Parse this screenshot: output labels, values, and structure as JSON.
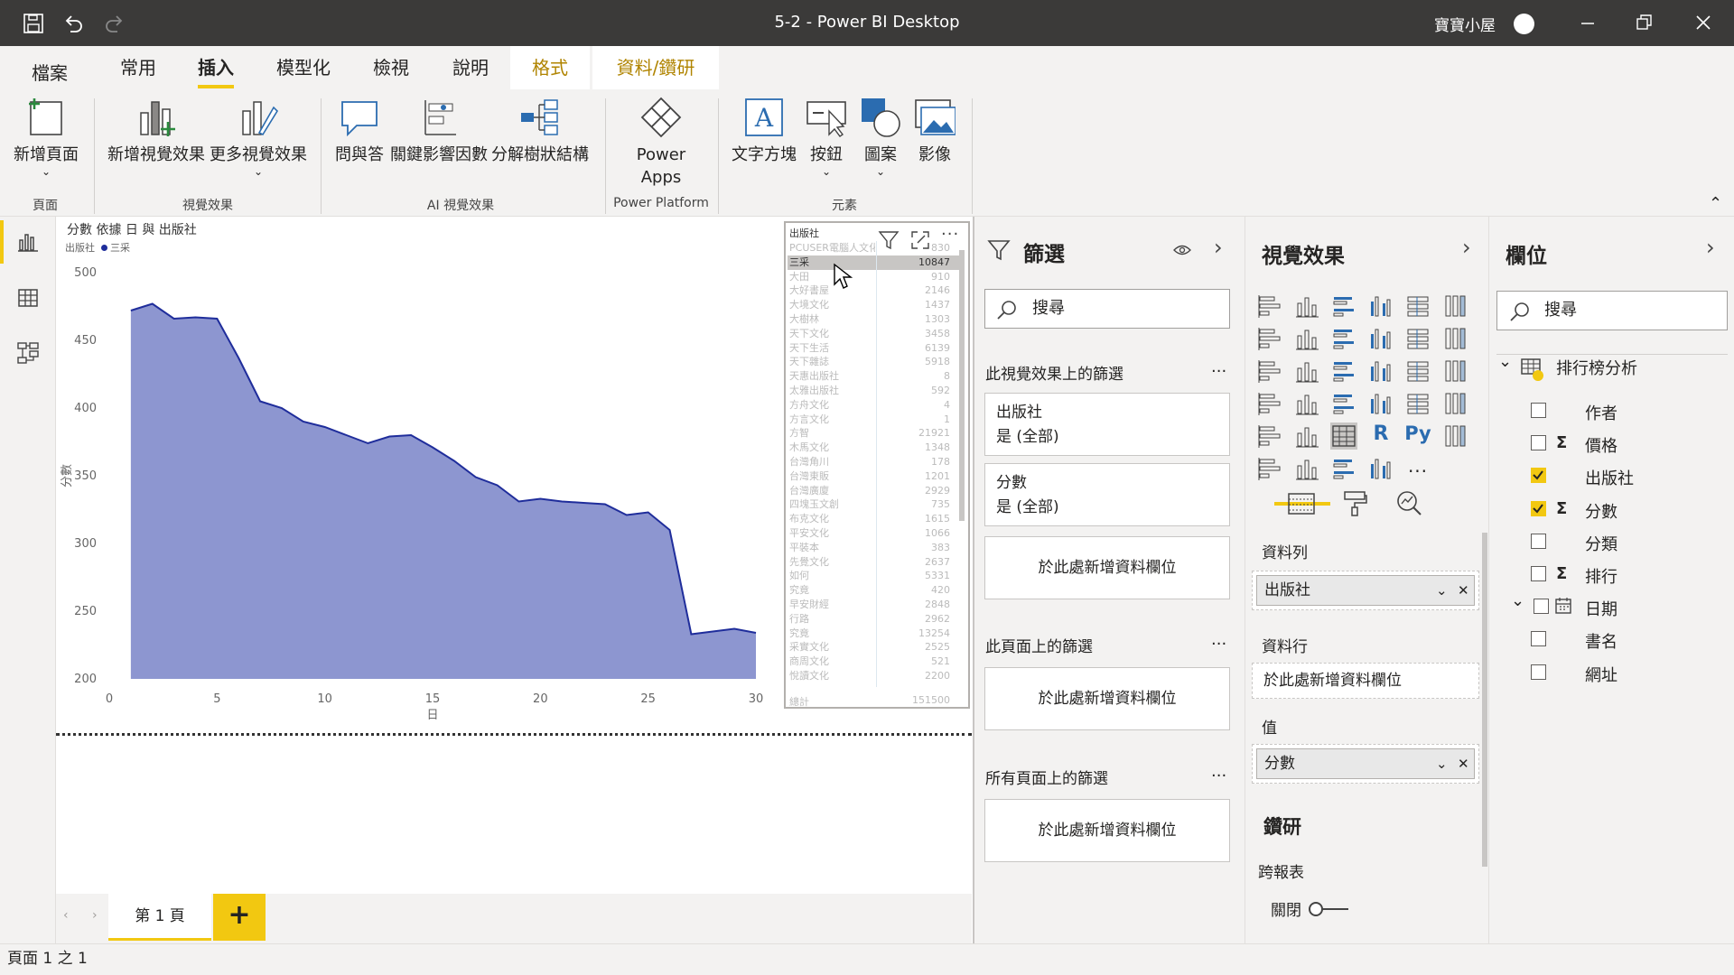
{
  "window": {
    "title": "5-2 - Power BI Desktop",
    "user": "寶寶小屋"
  },
  "tabs": [
    "檔案",
    "常用",
    "插入",
    "模型化",
    "檢視",
    "說明",
    "格式",
    "資料/鑽研"
  ],
  "ribbon": {
    "new_page": "新增頁面",
    "new_visual": "新增視覺效果",
    "more_visuals": "更多視覺效果",
    "qa": "問與答",
    "key_influencers": "關鍵影響因數",
    "decomp_tree": "分解樹狀結構",
    "power_apps_1": "Power",
    "power_apps_2": "Apps",
    "text_box": "文字方塊",
    "buttons": "按鈕",
    "shapes": "圖案",
    "image": "影像",
    "groups": {
      "page": "頁面",
      "visuals": "視覺效果",
      "ai": "AI 視覺效果",
      "platform": "Power Platform",
      "elements": "元素"
    }
  },
  "chart": {
    "title": "分數 依據 日 與 出版社",
    "legend_label": "出版社",
    "legend_item": "三采",
    "xlabel": "日",
    "ylabel": "分數"
  },
  "chart_data": {
    "type": "area",
    "title": "分數 依據 日 與 出版社",
    "xlabel": "日",
    "ylabel": "分數",
    "x": [
      1,
      2,
      3,
      4,
      5,
      6,
      7,
      8,
      9,
      10,
      11,
      12,
      13,
      14,
      15,
      16,
      17,
      18,
      19,
      20,
      21,
      22,
      23,
      24,
      25,
      26,
      27,
      28,
      29,
      30
    ],
    "series": [
      {
        "name": "三采",
        "values": [
          472,
          477,
          466,
          467,
          466,
          437,
          405,
          400,
          390,
          386,
          380,
          374,
          379,
          380,
          371,
          361,
          349,
          343,
          331,
          333,
          331,
          330,
          329,
          321,
          323,
          310,
          233,
          235,
          237,
          234
        ]
      }
    ],
    "xlim": [
      0,
      30
    ],
    "ylim": [
      200,
      500
    ],
    "xticks": [
      0,
      5,
      10,
      15,
      20,
      25,
      30
    ],
    "yticks": [
      200,
      250,
      300,
      350,
      400,
      450,
      500
    ],
    "grid": false,
    "legend": "top-left"
  },
  "table": {
    "header": "出版社",
    "rows": [
      {
        "name": "PCUSER電腦人文化",
        "value": "830"
      },
      {
        "name": "三采",
        "value": "10847"
      },
      {
        "name": "大田",
        "value": "910"
      },
      {
        "name": "大好書屋",
        "value": "2146"
      },
      {
        "name": "大境文化",
        "value": "1437"
      },
      {
        "name": "大樹林",
        "value": "1303"
      },
      {
        "name": "天下文化",
        "value": "3458"
      },
      {
        "name": "天下生活",
        "value": "6139"
      },
      {
        "name": "天下雜誌",
        "value": "5918"
      },
      {
        "name": "天惠出版社",
        "value": "8"
      },
      {
        "name": "太雅出版社",
        "value": "592"
      },
      {
        "name": "方舟文化",
        "value": "4"
      },
      {
        "name": "方言文化",
        "value": "1"
      },
      {
        "name": "方智",
        "value": "21921"
      },
      {
        "name": "木馬文化",
        "value": "1348"
      },
      {
        "name": "台灣角川",
        "value": "178"
      },
      {
        "name": "台灣東販",
        "value": "1201"
      },
      {
        "name": "台灣廣廈",
        "value": "2929"
      },
      {
        "name": "四塊玉文創",
        "value": "735"
      },
      {
        "name": "布克文化",
        "value": "1615"
      },
      {
        "name": "平安文化",
        "value": "1066"
      },
      {
        "name": "平裝本",
        "value": "383"
      },
      {
        "name": "先覺文化",
        "value": "2637"
      },
      {
        "name": "如何",
        "value": "5331"
      },
      {
        "name": "究竟",
        "value": "420"
      },
      {
        "name": "早安財經",
        "value": "2848"
      },
      {
        "name": "行路",
        "value": "2962"
      },
      {
        "name": "究竟",
        "value": "13254"
      },
      {
        "name": "采實文化",
        "value": "2525"
      },
      {
        "name": "商周文化",
        "value": "521"
      },
      {
        "name": "悅讀文化",
        "value": "2200"
      }
    ],
    "total_label": "總計",
    "total_value": "151500"
  },
  "filters": {
    "title": "篩選",
    "search": "搜尋",
    "visual_section": "此視覺效果上的篩選",
    "card1_name": "出版社",
    "card1_value": "是 (全部)",
    "card2_name": "分數",
    "card2_value": "是 (全部)",
    "add_field": "於此處新增資料欄位",
    "page_section": "此頁面上的篩選",
    "all_section": "所有頁面上的篩選",
    "more": "..."
  },
  "viz": {
    "title": "視覺效果",
    "rows_label": "資料列",
    "rows_field": "出版社",
    "cols_label": "資料行",
    "cols_add": "於此處新增資料欄位",
    "values_label": "值",
    "values_field": "分數",
    "drill": "鑽研",
    "cross_report": "跨報表",
    "toggle": "關閉",
    "r": "R",
    "py": "Py",
    "more": "..."
  },
  "fields": {
    "title": "欄位",
    "search": "搜尋",
    "table": "排行榜分析",
    "items": [
      {
        "label": "作者",
        "checked": false,
        "sigma": false
      },
      {
        "label": "價格",
        "checked": false,
        "sigma": true
      },
      {
        "label": "出版社",
        "checked": true,
        "sigma": false
      },
      {
        "label": "分數",
        "checked": true,
        "sigma": true
      },
      {
        "label": "分類",
        "checked": false,
        "sigma": false
      },
      {
        "label": "排行",
        "checked": false,
        "sigma": true
      },
      {
        "label": "日期",
        "checked": false,
        "sigma": false
      },
      {
        "label": "書名",
        "checked": false,
        "sigma": false
      },
      {
        "label": "網址",
        "checked": false,
        "sigma": false
      }
    ]
  },
  "pages": {
    "tab": "第 1 頁",
    "add": "+"
  },
  "status": "頁面 1 之 1",
  "colors": {
    "accent": "#f2c811",
    "area_fill": "#8d96d0",
    "area_line": "#1f2d9b",
    "titlebar": "#3b3a39"
  }
}
